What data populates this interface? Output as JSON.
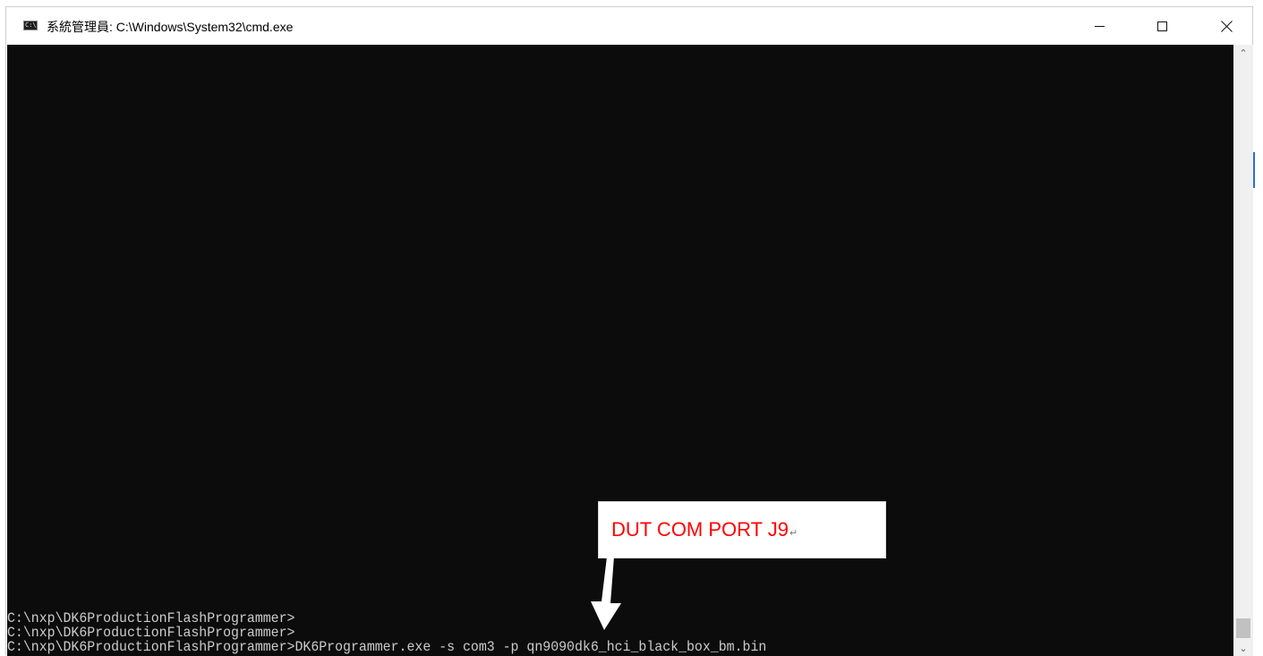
{
  "window": {
    "title": "系統管理員: C:\\Windows\\System32\\cmd.exe",
    "icon": "cmd-console-icon",
    "icon_glyph": "C:\\",
    "controls": {
      "minimize": "minimize-icon",
      "maximize": "maximize-icon",
      "close": "close-icon"
    }
  },
  "console": {
    "background": "#0c0c0c",
    "text_color": "#cccccc",
    "lines": [
      "C:\\nxp\\DK6ProductionFlashProgrammer>",
      "C:\\nxp\\DK6ProductionFlashProgrammer>",
      "C:\\nxp\\DK6ProductionFlashProgrammer>DK6Programmer.exe -s com3 -p qn9090dk6_hci_black_box_bm.bin"
    ]
  },
  "scrollbar": {
    "up_icon": "chevron-up-icon",
    "down_icon": "chevron-down-icon",
    "up_glyph": "⌃",
    "down_glyph": "⌄"
  },
  "annotation": {
    "label": "DUT COM PORT J9",
    "return_mark": "↵",
    "color": "#ff0000",
    "arrow_color": "#ffffff"
  }
}
